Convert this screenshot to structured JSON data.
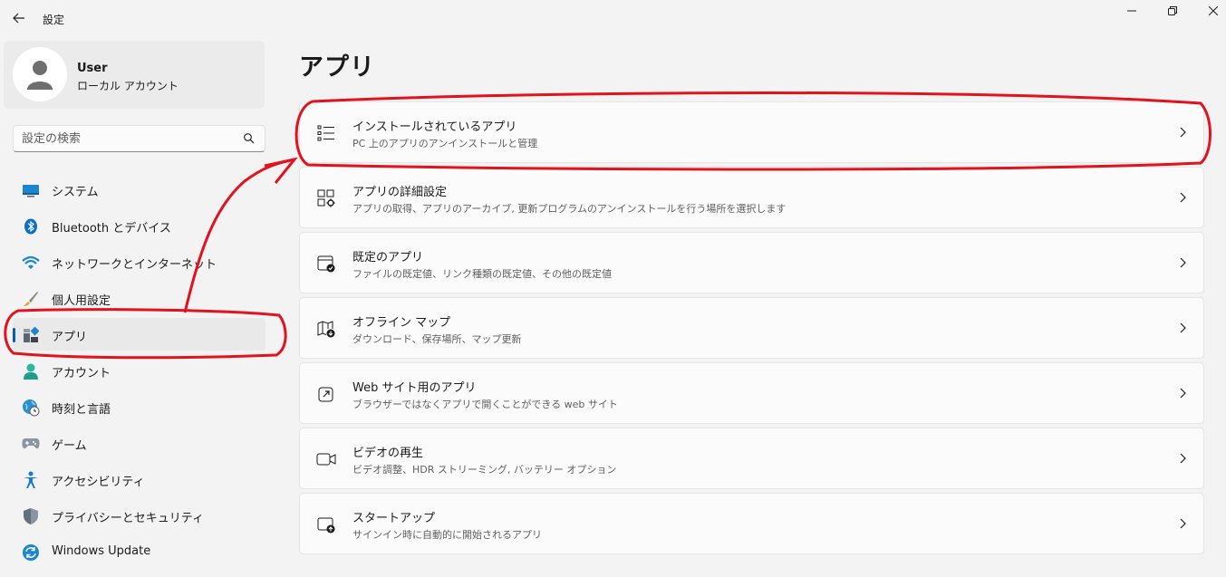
{
  "window": {
    "title": "設定",
    "back_icon": "arrow-left-icon",
    "controls": [
      "minimize-icon",
      "maximize-icon",
      "close-icon"
    ]
  },
  "user": {
    "name": "User",
    "account_type": "ローカル アカウント"
  },
  "search": {
    "placeholder": "設定の検索"
  },
  "sidebar": {
    "items": [
      {
        "label": "システム",
        "icon": "system-icon",
        "selected": false
      },
      {
        "label": "Bluetooth とデバイス",
        "icon": "bluetooth-icon",
        "selected": false
      },
      {
        "label": "ネットワークとインターネット",
        "icon": "wifi-icon",
        "selected": false
      },
      {
        "label": "個人用設定",
        "icon": "brush-icon",
        "selected": false
      },
      {
        "label": "アプリ",
        "icon": "apps-icon",
        "selected": true
      },
      {
        "label": "アカウント",
        "icon": "person-icon",
        "selected": false
      },
      {
        "label": "時刻と言語",
        "icon": "globe-clock-icon",
        "selected": false
      },
      {
        "label": "ゲーム",
        "icon": "gamepad-icon",
        "selected": false
      },
      {
        "label": "アクセシビリティ",
        "icon": "accessibility-icon",
        "selected": false
      },
      {
        "label": "プライバシーとセキュリティ",
        "icon": "shield-icon",
        "selected": false
      },
      {
        "label": "Windows Update",
        "icon": "update-icon",
        "selected": false
      }
    ]
  },
  "main": {
    "title": "アプリ",
    "cards": [
      {
        "title": "インストールされているアプリ",
        "description": "PC 上のアプリのアンインストールと管理",
        "icon": "list-icon"
      },
      {
        "title": "アプリの詳細設定",
        "description": "アプリの取得、アプリのアーカイブ, 更新プログラムのアンインストールを行う場所を選択します",
        "icon": "app-settings-icon"
      },
      {
        "title": "既定のアプリ",
        "description": "ファイルの既定値、リンク種類の既定値、その他の既定値",
        "icon": "default-apps-icon"
      },
      {
        "title": "オフライン マップ",
        "description": "ダウンロード、保存場所、マップ更新",
        "icon": "map-icon"
      },
      {
        "title": "Web サイト用のアプリ",
        "description": "ブラウザーではなくアプリで開くことができる web サイト",
        "icon": "open-external-icon"
      },
      {
        "title": "ビデオの再生",
        "description": "ビデオ調整、HDR ストリーミング, バッテリー オプション",
        "icon": "video-icon"
      },
      {
        "title": "スタートアップ",
        "description": "サインイン時に自動的に開始されるアプリ",
        "icon": "startup-icon"
      }
    ]
  },
  "colors": {
    "accent": "#005fb8",
    "annotation": "#e0131f"
  }
}
